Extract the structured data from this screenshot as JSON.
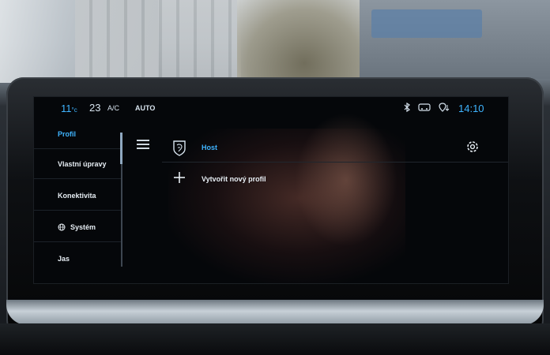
{
  "statusbar": {
    "temp_left": "11",
    "fan_speed": "23",
    "ac_label": "A/C",
    "auto_label": "AUTO",
    "time": "14:10",
    "icons": [
      "bluetooth-icon",
      "car-connect-icon",
      "location-icon"
    ]
  },
  "sidebar": {
    "items": [
      {
        "label": "Profil",
        "active": true
      },
      {
        "label": "Vlastní úpravy"
      },
      {
        "label": "Konektivita"
      },
      {
        "label": "Systém",
        "icon": "globe-icon"
      },
      {
        "label": "Jas"
      }
    ]
  },
  "main": {
    "host_label": "Host",
    "new_profile_label": "Vytvořit nový profil"
  },
  "colors": {
    "accent": "#3fb4ff",
    "text": "#e6edf3",
    "screen_bg": "#05070a"
  }
}
